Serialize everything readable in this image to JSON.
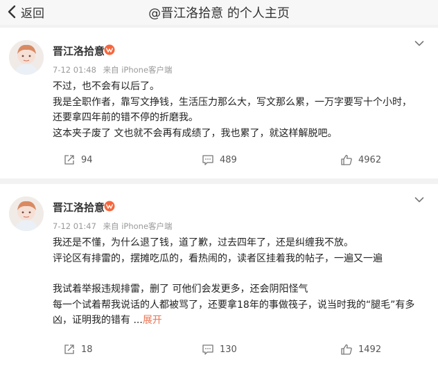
{
  "header": {
    "back_label": "返回",
    "title": "@晋江洛拾意 的个人主页"
  },
  "posts": [
    {
      "username": "晋江洛拾意",
      "time": "7-12 01:48",
      "source": "来自 iPhone客户端",
      "lines": [
        "不过，也不会有以后了。",
        "我是全职作者，靠写文挣钱，生活压力那么大，写文那么累，一万字要写十个小时，",
        "还要拿四年前的错不停的折磨我。",
        "这本夹子废了 文也就不会再有成绩了，我也累了，就这样解脱吧。"
      ],
      "reposts": "94",
      "comments": "489",
      "likes": "4962"
    },
    {
      "username": "晋江洛拾意",
      "time": "7-12 01:47",
      "source": "来自 iPhone客户端",
      "lines": [
        "我还是不懂，为什么退了钱，道了歉，过去四年了，还是纠缠我不放。",
        "评论区有排雷的，摆摊吃瓜的，看热闹的，读者区挂着我的帖子，一遍又一遍",
        "我试着举报违规排雷，删了 可他们会发更多，还会阴阳怪气",
        "每一个试着帮我说话的人都被骂了，还要拿18年的事做筏子，说当时我的“腿毛”有多",
        "凶，证明我的错有 ..."
      ],
      "expand_label": "展开",
      "reposts": "18",
      "comments": "130",
      "likes": "1492"
    }
  ],
  "icons": {
    "back": "chevron-left-icon",
    "more": "chevron-down-icon",
    "repost": "share-icon",
    "comment": "comment-icon",
    "like": "thumbs-up-icon",
    "vip": "vip-badge-icon"
  },
  "colors": {
    "expand": "#eb7350",
    "vip_badge": "#f7663c",
    "meta_text": "#999999"
  }
}
